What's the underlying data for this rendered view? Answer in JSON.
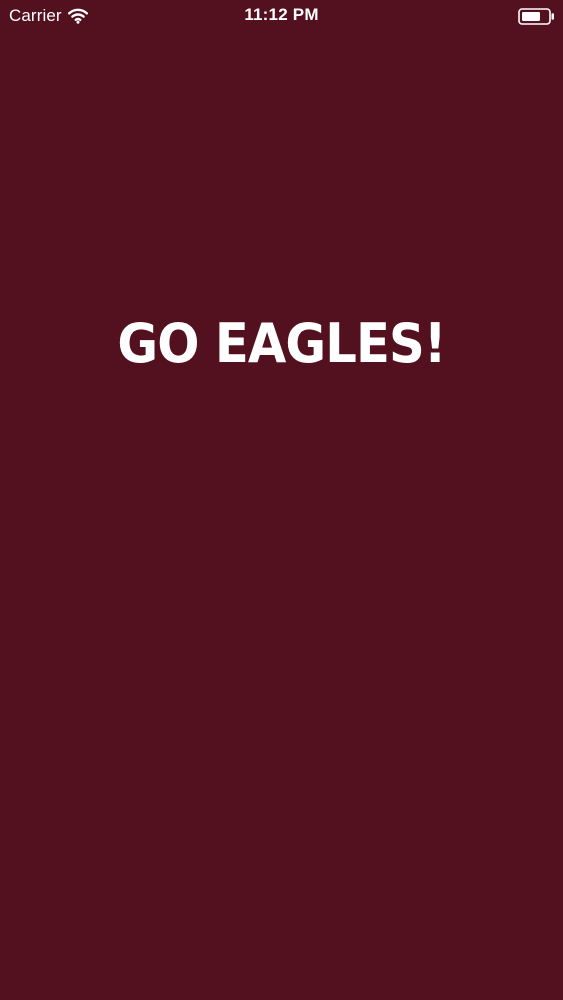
{
  "status_bar": {
    "carrier": "Carrier",
    "time": "11:12 PM",
    "icons": {
      "wifi": "wifi-icon",
      "battery": "battery-icon"
    }
  },
  "main": {
    "title": "GO EAGLES!"
  },
  "colors": {
    "background": "#53101f",
    "text": "#ffffff"
  }
}
